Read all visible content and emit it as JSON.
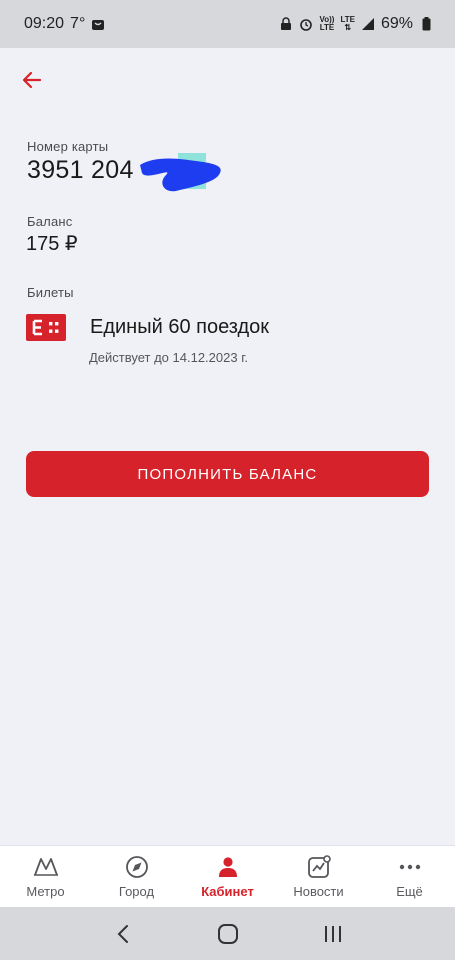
{
  "status_bar": {
    "time": "09:20",
    "temperature": "7°",
    "lte1": "Vo))",
    "lte2": "LTE",
    "battery": "69%"
  },
  "card": {
    "number_label": "Номер карты",
    "number": "3951 204",
    "balance_label": "Баланс",
    "balance": "175 ₽"
  },
  "tickets": {
    "label": "Билеты",
    "items": [
      {
        "name": "Единый 60 поездок",
        "valid_until": "Действует до 14.12.2023 г."
      }
    ]
  },
  "actions": {
    "topup_label": "ПОПОЛНИТЬ БАЛАНС"
  },
  "bottom_nav": {
    "items": [
      {
        "label": "Метро",
        "icon": "metro-icon"
      },
      {
        "label": "Город",
        "icon": "compass-icon"
      },
      {
        "label": "Кабинет",
        "icon": "person-icon"
      },
      {
        "label": "Новости",
        "icon": "chart-icon"
      },
      {
        "label": "Ещё",
        "icon": "more-icon"
      }
    ],
    "active_index": 2
  },
  "colors": {
    "accent": "#d6222a",
    "background": "#f0f1f6",
    "redaction": "#1f3df0"
  }
}
